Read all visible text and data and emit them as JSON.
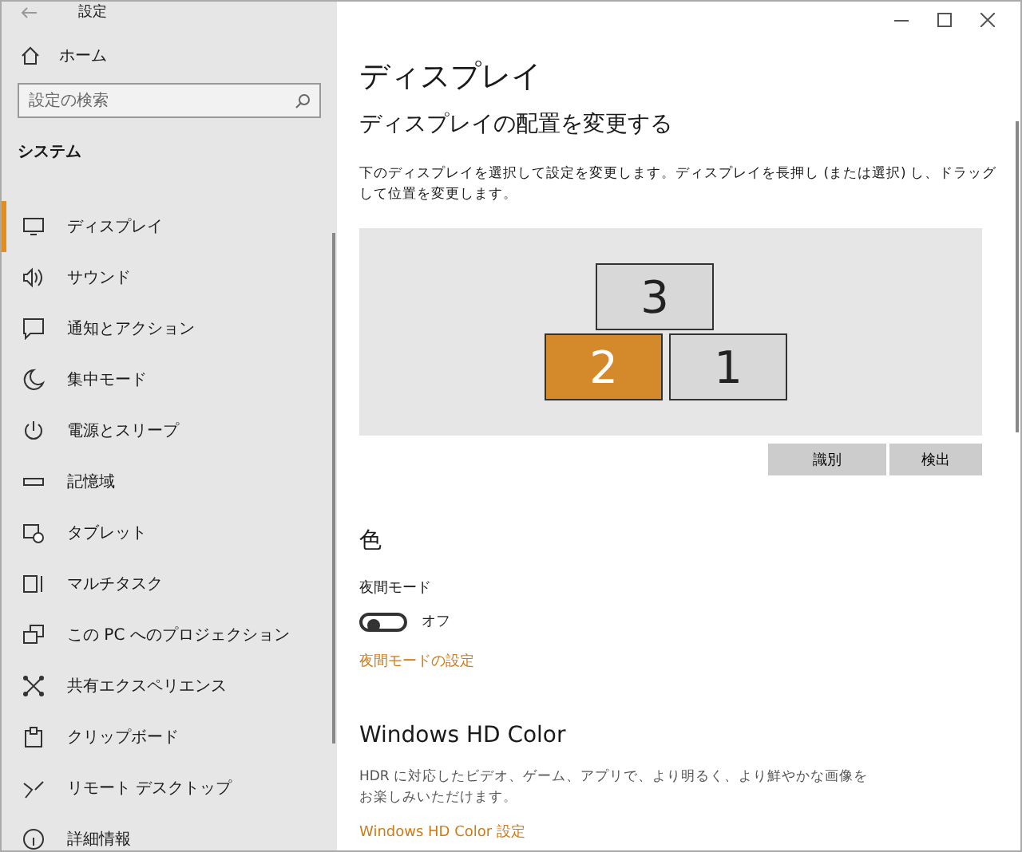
{
  "window": {
    "title": "設定"
  },
  "sidebar": {
    "home": "ホーム",
    "search": {
      "placeholder": "設定の検索"
    },
    "section": "システム",
    "items": [
      {
        "label": "ディスプレイ",
        "selected": true
      },
      {
        "label": "サウンド",
        "selected": false
      },
      {
        "label": "通知とアクション",
        "selected": false
      },
      {
        "label": "集中モード",
        "selected": false
      },
      {
        "label": "電源とスリープ",
        "selected": false
      },
      {
        "label": "記憶域",
        "selected": false
      },
      {
        "label": "タブレット",
        "selected": false
      },
      {
        "label": "マルチタスク",
        "selected": false
      },
      {
        "label": "この PC へのプロジェクション",
        "selected": false
      },
      {
        "label": "共有エクスペリエンス",
        "selected": false
      },
      {
        "label": "クリップボード",
        "selected": false
      },
      {
        "label": "リモート デスクトップ",
        "selected": false
      },
      {
        "label": "詳細情報",
        "selected": false
      }
    ]
  },
  "page": {
    "title": "ディスプレイ",
    "arrange": {
      "heading": "ディスプレイの配置を変更する",
      "description": "下のディスプレイを選択して設定を変更します。ディスプレイを長押し (または選択) し、ドラッグして位置を変更します。",
      "monitors": [
        {
          "label": "3",
          "selected": false
        },
        {
          "label": "2",
          "selected": true
        },
        {
          "label": "1",
          "selected": false
        }
      ],
      "buttons": [
        "識別",
        "検出"
      ]
    },
    "color": {
      "heading": "色",
      "night_light": {
        "label": "夜間モード",
        "on": false,
        "state_text": "オフ"
      },
      "link": "夜間モードの設定"
    },
    "hdr": {
      "heading": "Windows HD Color",
      "description": "HDR に対応したビデオ、ゲーム、アプリで、より明るく、より鮮やかな画像をお楽しみいただけます。",
      "link": "Windows HD Color 設定"
    }
  }
}
